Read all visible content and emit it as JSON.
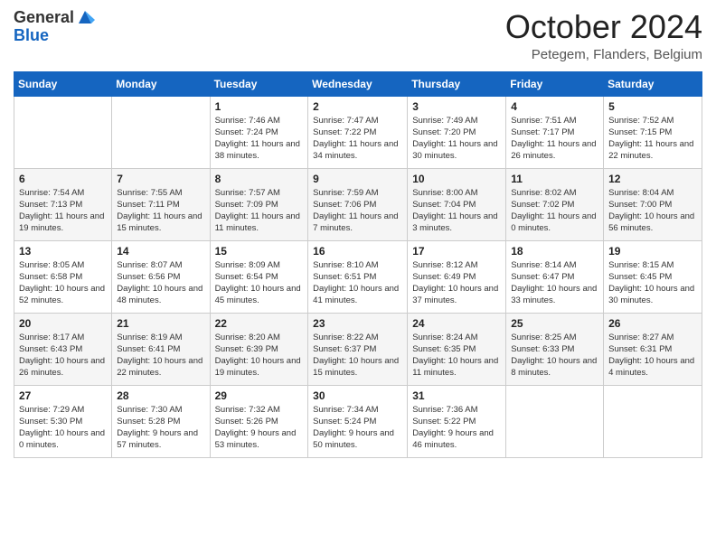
{
  "header": {
    "logo_general": "General",
    "logo_blue": "Blue",
    "month_title": "October 2024",
    "subtitle": "Petegem, Flanders, Belgium"
  },
  "days_of_week": [
    "Sunday",
    "Monday",
    "Tuesday",
    "Wednesday",
    "Thursday",
    "Friday",
    "Saturday"
  ],
  "weeks": [
    [
      {
        "day": "",
        "sunrise": "",
        "sunset": "",
        "daylight": ""
      },
      {
        "day": "",
        "sunrise": "",
        "sunset": "",
        "daylight": ""
      },
      {
        "day": "1",
        "sunrise": "Sunrise: 7:46 AM",
        "sunset": "Sunset: 7:24 PM",
        "daylight": "Daylight: 11 hours and 38 minutes."
      },
      {
        "day": "2",
        "sunrise": "Sunrise: 7:47 AM",
        "sunset": "Sunset: 7:22 PM",
        "daylight": "Daylight: 11 hours and 34 minutes."
      },
      {
        "day": "3",
        "sunrise": "Sunrise: 7:49 AM",
        "sunset": "Sunset: 7:20 PM",
        "daylight": "Daylight: 11 hours and 30 minutes."
      },
      {
        "day": "4",
        "sunrise": "Sunrise: 7:51 AM",
        "sunset": "Sunset: 7:17 PM",
        "daylight": "Daylight: 11 hours and 26 minutes."
      },
      {
        "day": "5",
        "sunrise": "Sunrise: 7:52 AM",
        "sunset": "Sunset: 7:15 PM",
        "daylight": "Daylight: 11 hours and 22 minutes."
      }
    ],
    [
      {
        "day": "6",
        "sunrise": "Sunrise: 7:54 AM",
        "sunset": "Sunset: 7:13 PM",
        "daylight": "Daylight: 11 hours and 19 minutes."
      },
      {
        "day": "7",
        "sunrise": "Sunrise: 7:55 AM",
        "sunset": "Sunset: 7:11 PM",
        "daylight": "Daylight: 11 hours and 15 minutes."
      },
      {
        "day": "8",
        "sunrise": "Sunrise: 7:57 AM",
        "sunset": "Sunset: 7:09 PM",
        "daylight": "Daylight: 11 hours and 11 minutes."
      },
      {
        "day": "9",
        "sunrise": "Sunrise: 7:59 AM",
        "sunset": "Sunset: 7:06 PM",
        "daylight": "Daylight: 11 hours and 7 minutes."
      },
      {
        "day": "10",
        "sunrise": "Sunrise: 8:00 AM",
        "sunset": "Sunset: 7:04 PM",
        "daylight": "Daylight: 11 hours and 3 minutes."
      },
      {
        "day": "11",
        "sunrise": "Sunrise: 8:02 AM",
        "sunset": "Sunset: 7:02 PM",
        "daylight": "Daylight: 11 hours and 0 minutes."
      },
      {
        "day": "12",
        "sunrise": "Sunrise: 8:04 AM",
        "sunset": "Sunset: 7:00 PM",
        "daylight": "Daylight: 10 hours and 56 minutes."
      }
    ],
    [
      {
        "day": "13",
        "sunrise": "Sunrise: 8:05 AM",
        "sunset": "Sunset: 6:58 PM",
        "daylight": "Daylight: 10 hours and 52 minutes."
      },
      {
        "day": "14",
        "sunrise": "Sunrise: 8:07 AM",
        "sunset": "Sunset: 6:56 PM",
        "daylight": "Daylight: 10 hours and 48 minutes."
      },
      {
        "day": "15",
        "sunrise": "Sunrise: 8:09 AM",
        "sunset": "Sunset: 6:54 PM",
        "daylight": "Daylight: 10 hours and 45 minutes."
      },
      {
        "day": "16",
        "sunrise": "Sunrise: 8:10 AM",
        "sunset": "Sunset: 6:51 PM",
        "daylight": "Daylight: 10 hours and 41 minutes."
      },
      {
        "day": "17",
        "sunrise": "Sunrise: 8:12 AM",
        "sunset": "Sunset: 6:49 PM",
        "daylight": "Daylight: 10 hours and 37 minutes."
      },
      {
        "day": "18",
        "sunrise": "Sunrise: 8:14 AM",
        "sunset": "Sunset: 6:47 PM",
        "daylight": "Daylight: 10 hours and 33 minutes."
      },
      {
        "day": "19",
        "sunrise": "Sunrise: 8:15 AM",
        "sunset": "Sunset: 6:45 PM",
        "daylight": "Daylight: 10 hours and 30 minutes."
      }
    ],
    [
      {
        "day": "20",
        "sunrise": "Sunrise: 8:17 AM",
        "sunset": "Sunset: 6:43 PM",
        "daylight": "Daylight: 10 hours and 26 minutes."
      },
      {
        "day": "21",
        "sunrise": "Sunrise: 8:19 AM",
        "sunset": "Sunset: 6:41 PM",
        "daylight": "Daylight: 10 hours and 22 minutes."
      },
      {
        "day": "22",
        "sunrise": "Sunrise: 8:20 AM",
        "sunset": "Sunset: 6:39 PM",
        "daylight": "Daylight: 10 hours and 19 minutes."
      },
      {
        "day": "23",
        "sunrise": "Sunrise: 8:22 AM",
        "sunset": "Sunset: 6:37 PM",
        "daylight": "Daylight: 10 hours and 15 minutes."
      },
      {
        "day": "24",
        "sunrise": "Sunrise: 8:24 AM",
        "sunset": "Sunset: 6:35 PM",
        "daylight": "Daylight: 10 hours and 11 minutes."
      },
      {
        "day": "25",
        "sunrise": "Sunrise: 8:25 AM",
        "sunset": "Sunset: 6:33 PM",
        "daylight": "Daylight: 10 hours and 8 minutes."
      },
      {
        "day": "26",
        "sunrise": "Sunrise: 8:27 AM",
        "sunset": "Sunset: 6:31 PM",
        "daylight": "Daylight: 10 hours and 4 minutes."
      }
    ],
    [
      {
        "day": "27",
        "sunrise": "Sunrise: 7:29 AM",
        "sunset": "Sunset: 5:30 PM",
        "daylight": "Daylight: 10 hours and 0 minutes."
      },
      {
        "day": "28",
        "sunrise": "Sunrise: 7:30 AM",
        "sunset": "Sunset: 5:28 PM",
        "daylight": "Daylight: 9 hours and 57 minutes."
      },
      {
        "day": "29",
        "sunrise": "Sunrise: 7:32 AM",
        "sunset": "Sunset: 5:26 PM",
        "daylight": "Daylight: 9 hours and 53 minutes."
      },
      {
        "day": "30",
        "sunrise": "Sunrise: 7:34 AM",
        "sunset": "Sunset: 5:24 PM",
        "daylight": "Daylight: 9 hours and 50 minutes."
      },
      {
        "day": "31",
        "sunrise": "Sunrise: 7:36 AM",
        "sunset": "Sunset: 5:22 PM",
        "daylight": "Daylight: 9 hours and 46 minutes."
      },
      {
        "day": "",
        "sunrise": "",
        "sunset": "",
        "daylight": ""
      },
      {
        "day": "",
        "sunrise": "",
        "sunset": "",
        "daylight": ""
      }
    ]
  ]
}
